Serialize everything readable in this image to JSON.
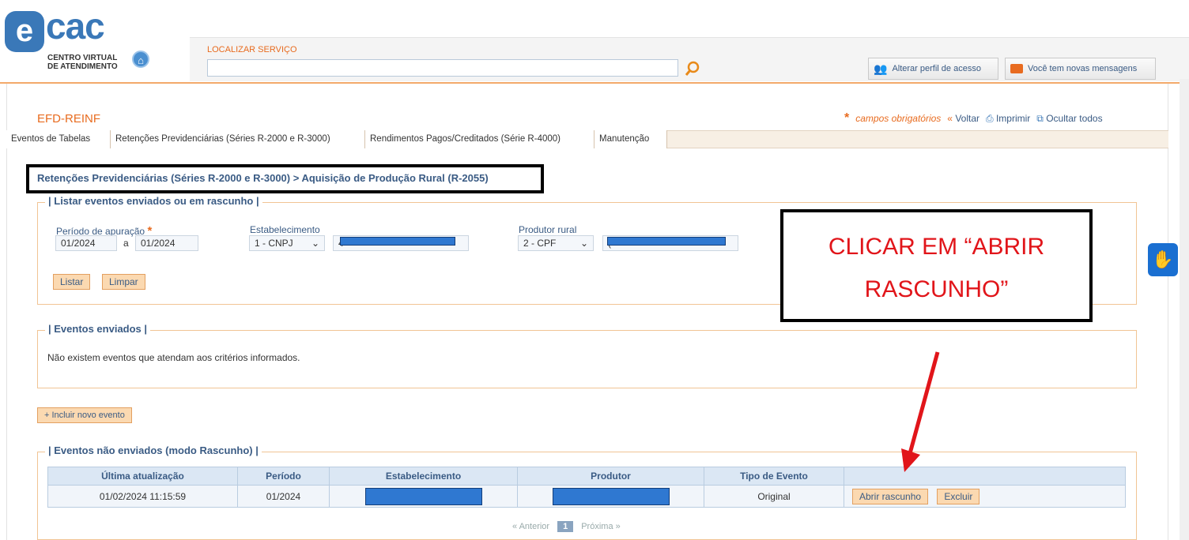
{
  "logo": {
    "name": "cac",
    "subtitle_line1": "CENTRO VIRTUAL",
    "subtitle_line2": "DE ATENDIMENTO"
  },
  "search": {
    "label": "LOCALIZAR SERVIÇO",
    "value": ""
  },
  "top_buttons": {
    "perfil": "Alterar perfil de acesso",
    "mensagens": "Você tem novas mensagens"
  },
  "page": {
    "title": "EFD-REINF"
  },
  "tools": {
    "required_star": "*",
    "required_text": "campos obrigatórios",
    "back": "Voltar",
    "print": "Imprimir",
    "hide_all": "Ocultar todos"
  },
  "tabs": [
    {
      "label": "Eventos de Tabelas"
    },
    {
      "label": "Retenções Previdenciárias (Séries R-2000 e R-3000)"
    },
    {
      "label": "Rendimentos Pagos/Creditados (Série R-4000)"
    },
    {
      "label": "Manutenção"
    }
  ],
  "breadcrumb": "Retenções Previdenciárias (Séries R-2000 e R-3000) > Aquisição de Produção Rural (R-2055)",
  "filter": {
    "legend": "| Listar eventos enviados ou em rascunho |",
    "periodo_label": "Período de apuração",
    "periodo_required": "*",
    "periodo_inicio": "01/2024",
    "periodo_sep": "a",
    "periodo_fim": "01/2024",
    "estab_label": "Estabelecimento",
    "estab_tipo": "1 - CNPJ",
    "estab_value_prefix": "4",
    "produtor_label": "Produtor rural",
    "produtor_tipo": "2 - CPF",
    "produtor_value_prefix": "(",
    "btn_listar": "Listar",
    "btn_limpar": "Limpar"
  },
  "enviados": {
    "legend": "| Eventos enviados |",
    "empty_msg": "Não existem eventos que atendam aos critérios informados."
  },
  "btn_incluir": "+ Incluir novo evento",
  "rascunho": {
    "legend": "| Eventos não enviados (modo Rascunho) |",
    "columns": [
      "Última atualização",
      "Período",
      "Estabelecimento",
      "Produtor",
      "Tipo de Evento",
      ""
    ],
    "rows": [
      {
        "atualizacao": "01/02/2024 11:15:59",
        "periodo": "01/2024",
        "tipo": "Original",
        "btn_abrir": "Abrir rascunho",
        "btn_excluir": "Excluir"
      }
    ]
  },
  "pager": {
    "prev": "« Anterior",
    "current": "1",
    "next": "Próxima »"
  },
  "instruction": {
    "line1": "CLICAR EM “ABRIR",
    "line2": "RASCUNHO”"
  },
  "colors": {
    "accent": "#e86b1f",
    "link": "#3a5b84",
    "annotation": "#e1151a",
    "mask": "#2f78d1"
  }
}
